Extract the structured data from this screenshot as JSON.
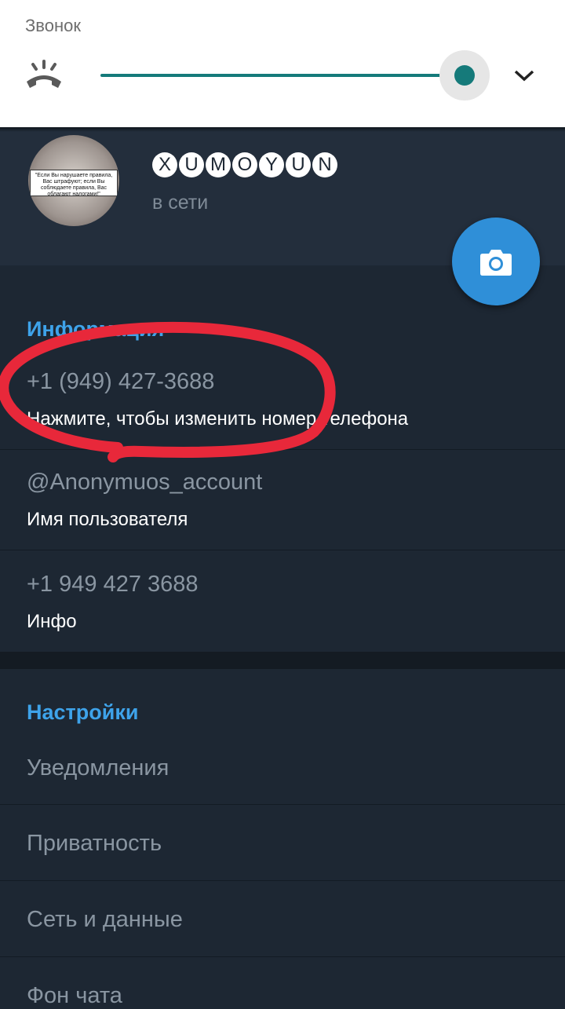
{
  "volume_panel": {
    "label": "Звонок",
    "ringer_level": 1.0,
    "accent_color": "#157a7a"
  },
  "profile": {
    "name_letters": [
      "X",
      "U",
      "M",
      "O",
      "Y",
      "U",
      "N"
    ],
    "status": "в сети",
    "avatar_text": "\"Если Вы нарушаете правила, Вас штрафуют; если Вы соблюдаете правила, Вас облагают налогами!\""
  },
  "info": {
    "section_title": "Информация",
    "phone": "+1 (949) 427-3688",
    "phone_hint": "Нажмите, чтобы изменить номер телефона",
    "username": "@Anonymuos_account",
    "username_label": "Имя пользователя",
    "bio": "+1 949 427 3688",
    "bio_label": "Инфо"
  },
  "settings": {
    "section_title": "Настройки",
    "items": [
      "Уведомления",
      "Приватность",
      "Сеть и данные",
      "Фон чата"
    ]
  },
  "colors": {
    "accent_blue": "#3ea3ea",
    "fab": "#2f8fd8",
    "annotation": "#e8283a"
  }
}
